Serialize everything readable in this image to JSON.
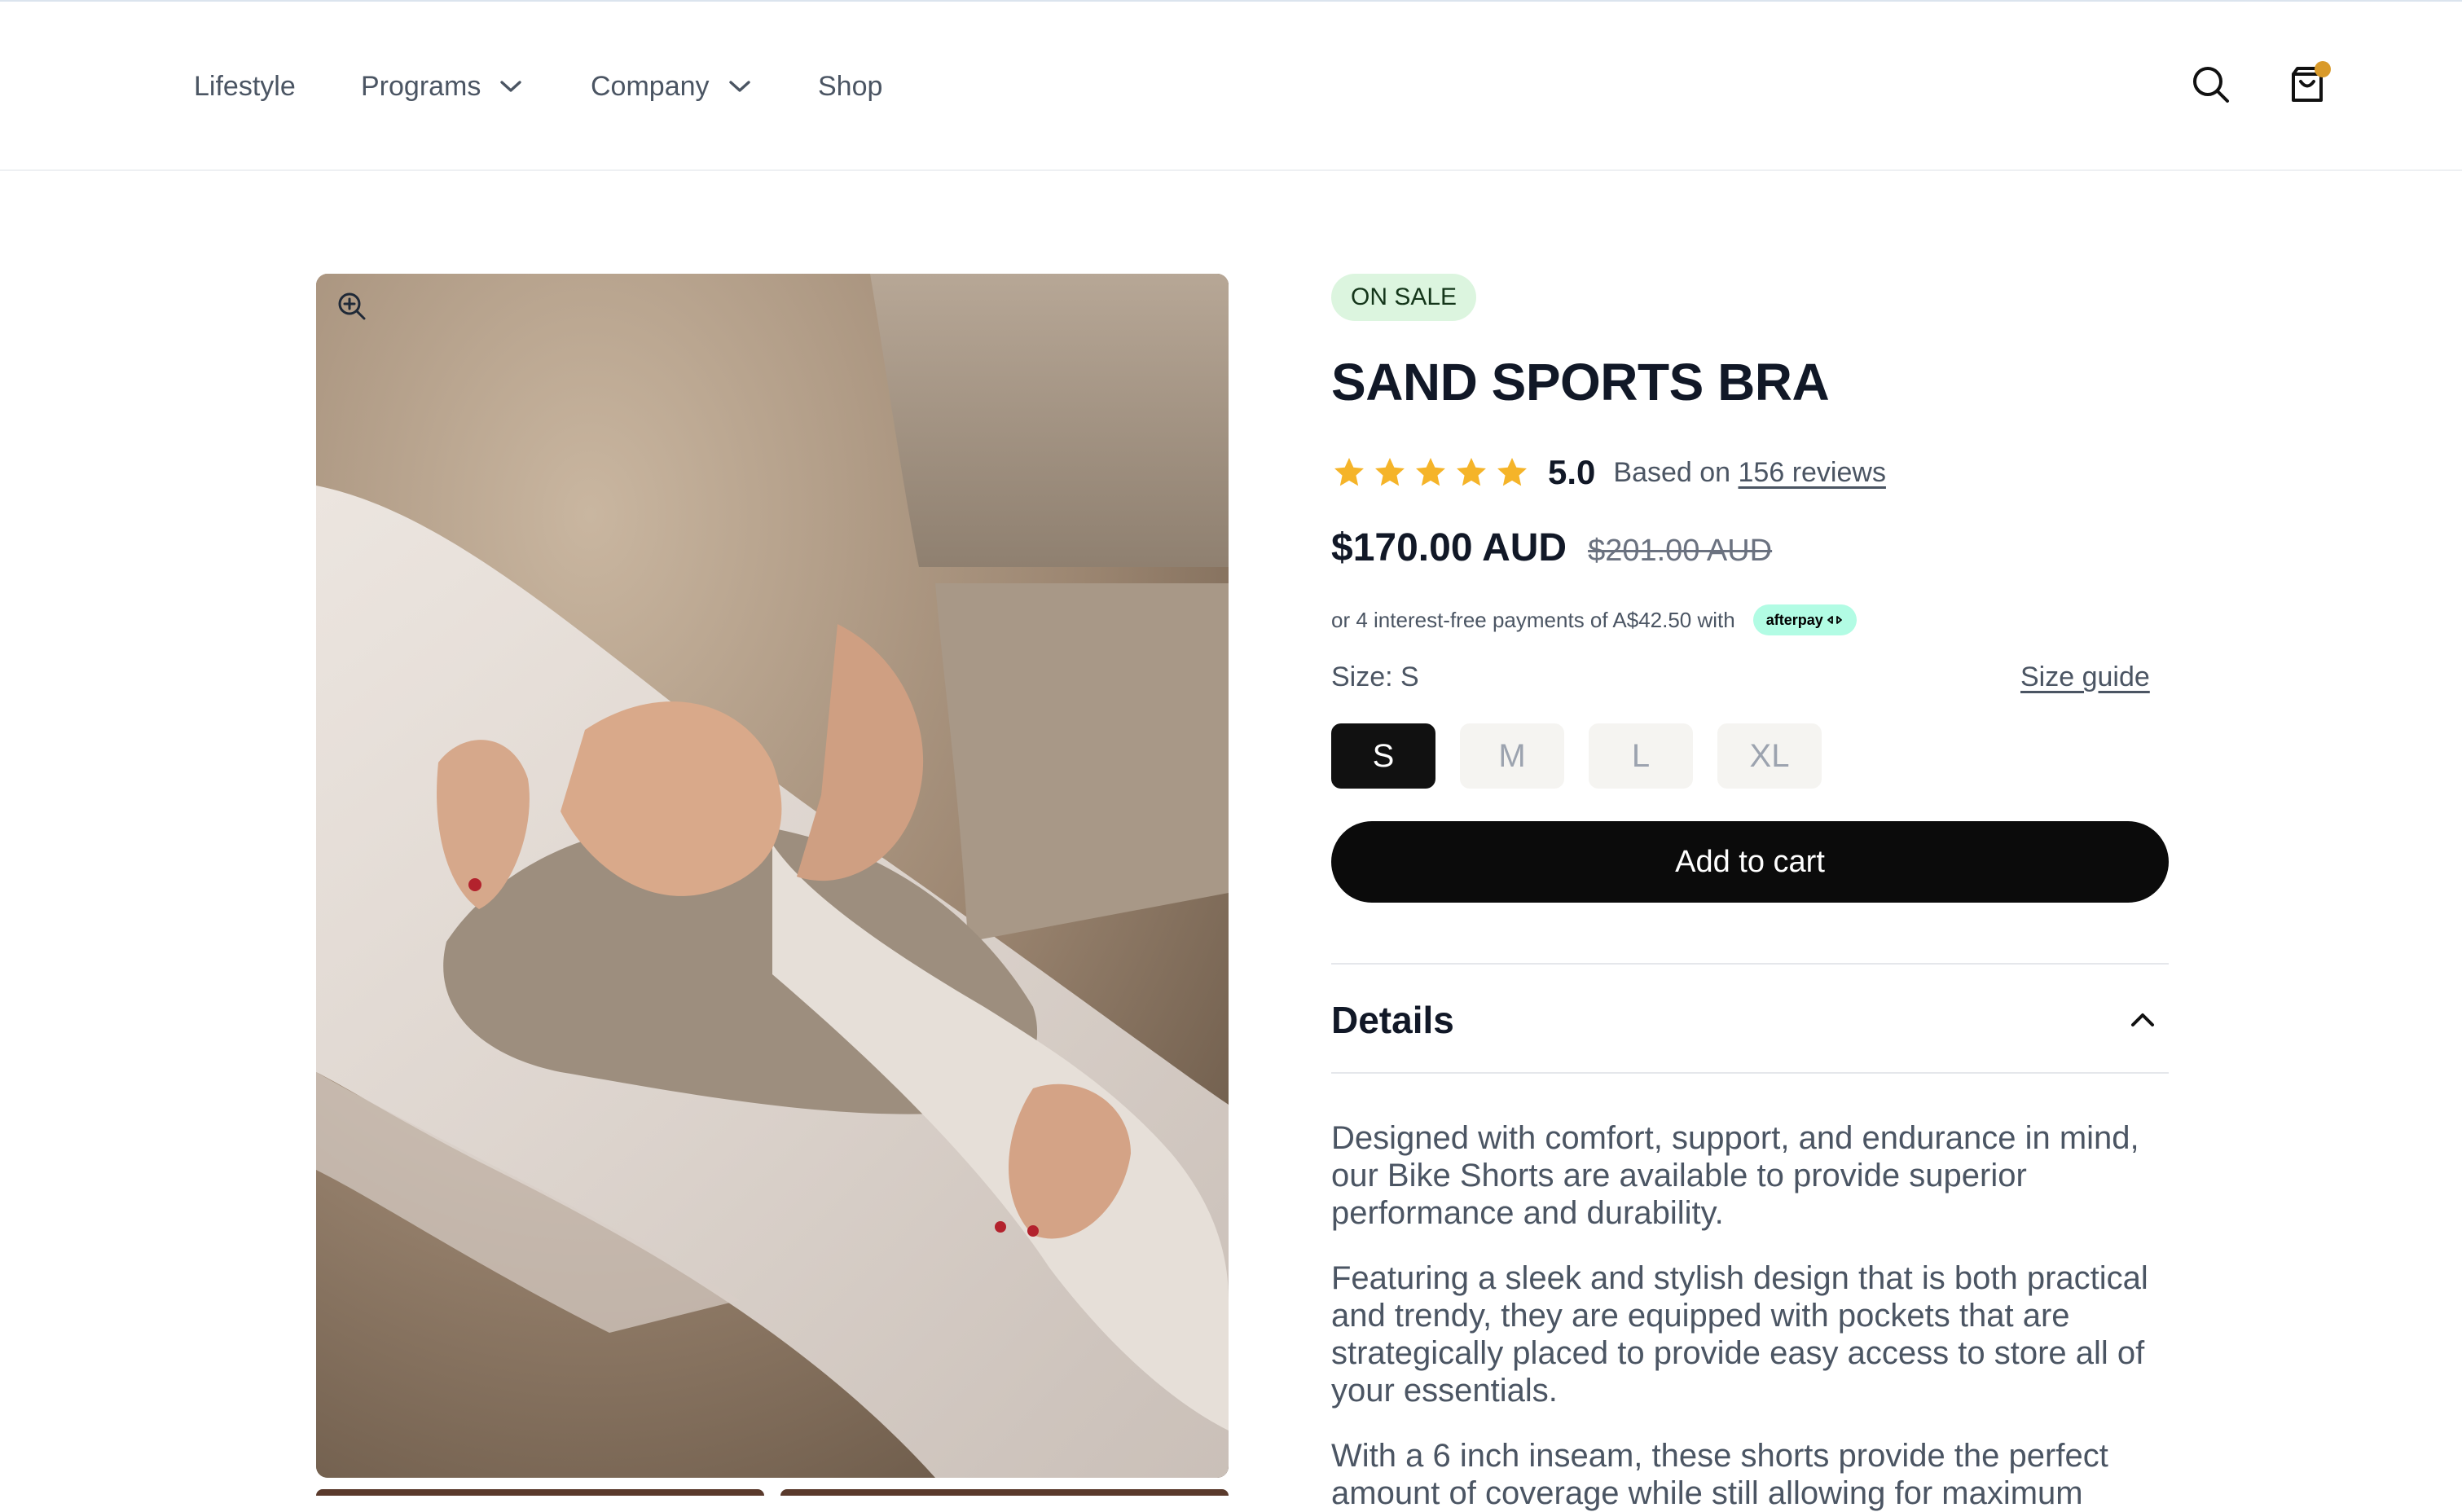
{
  "nav": {
    "items": [
      {
        "label": "Lifestyle",
        "dropdown": false
      },
      {
        "label": "Programs",
        "dropdown": true
      },
      {
        "label": "Company",
        "dropdown": true
      },
      {
        "label": "Shop",
        "dropdown": false
      }
    ],
    "icons": {
      "search": "search-icon",
      "cart": "shopping-bag-icon"
    },
    "cart_indicator_color": "#d99a2a"
  },
  "product": {
    "badge": "ON SALE",
    "title": "SAND SPORTS BRA",
    "rating": {
      "stars": 5,
      "score": "5.0",
      "text_prefix": "Based on",
      "reviews_link": "156 reviews",
      "star_color": "#f5b429"
    },
    "price": "$170.00 AUD",
    "old_price": "$201.00 AUD",
    "afterpay": {
      "text": "or 4 interest-free payments of A$42.50 with",
      "badge": "afterpay"
    },
    "size": {
      "label": "Size: S",
      "guide_link": "Size guide",
      "options": [
        "S",
        "M",
        "L",
        "XL"
      ],
      "selected": "S"
    },
    "add_to_cart": "Add to cart",
    "details": {
      "heading": "Details",
      "paragraphs": [
        "Designed with comfort, support, and endurance in mind, our Bike Shorts are available to provide superior performance and durability.",
        "Featuring a sleek and stylish design that is both practical and trendy, they are equipped with pockets that are strategically placed to provide easy access to store all of your essentials.",
        "With a 6 inch inseam, these shorts provide the perfect amount of coverage while still allowing for maximum"
      ]
    }
  },
  "colors": {
    "text_primary": "#111827",
    "text_secondary": "#4b5563",
    "badge_bg": "#dcf5df",
    "button_bg": "#0b0b0b",
    "afterpay_bg": "#b2fce4"
  }
}
